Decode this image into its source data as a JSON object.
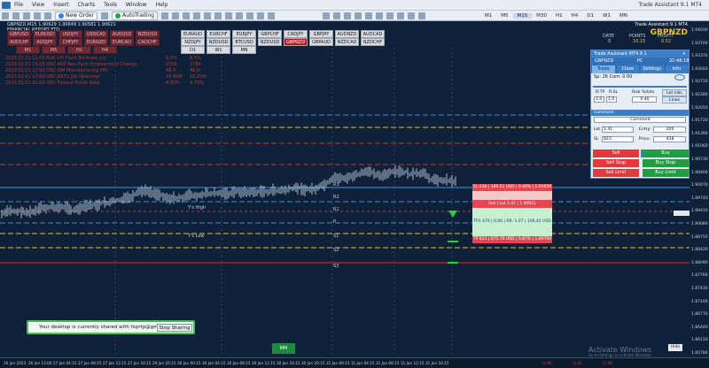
{
  "menu": {
    "items": [
      "File",
      "View",
      "Insert",
      "Charts",
      "Tools",
      "Window",
      "Help"
    ],
    "window_caption": "Trade Assistant 9.1 MT4"
  },
  "toolbar": {
    "new_order": "New Order",
    "autotrading": "AutoTrading",
    "timeframes": [
      "M1",
      "M5",
      "M15",
      "M30",
      "H1",
      "H4",
      "D1",
      "W1",
      "MN"
    ],
    "active_timeframe": "M15"
  },
  "chart": {
    "header": "GBPNZD,M15  1.90629 1.90649 1.90581 1.90621",
    "subtitle": "FINANCIAL REPORT FTD",
    "pairs_row1": [
      "GBPUSD",
      "EURUSD",
      "USDJPY",
      "USDCAD",
      "AUDUSD",
      "NZDUSD",
      "EURAUD",
      "EURCHF",
      "EURJPY",
      "GBPCHF",
      "CADJPY",
      "GBPJPY",
      "AUDNZD",
      "AUDCAD"
    ],
    "pairs_row2": [
      "AUDCHF",
      "AUDJPY",
      "CHFJPY",
      "EURNZD",
      "EURCAD",
      "CADCHF",
      "NZDJPY",
      "NZDUSD",
      "BTCUSD",
      "NZDUSD",
      "GBPNZD",
      "GBPAUD",
      "NZDCAD",
      "NZDCHF"
    ],
    "active_pair": "GBPNZD",
    "tf_buttons": [
      "M1",
      "M5",
      "H1",
      "H4",
      "D1",
      "W1",
      "MN"
    ],
    "news": [
      {
        "time": "2023.01.31 12:00",
        "event": "EUR  CPI Flash Estimate y/y",
        "act": "9.2%",
        "fcst": "8.5%"
      },
      {
        "time": "2023.02.01 15:15",
        "event": "USD  ADP Non-Farm Employment Change",
        "act": "235K",
        "fcst": "178K"
      },
      {
        "time": "2023.02.01 17:00",
        "event": "USD  ISM Manufacturing PMI",
        "act": "48.4",
        "fcst": "48.0"
      },
      {
        "time": "2023.02.01 17:00",
        "event": "USD  JOLTS Job Openings",
        "act": "10.46M",
        "fcst": "10.25M"
      },
      {
        "time": "2023.02.01 21:00",
        "event": "USD  Federal Funds Rate",
        "act": "4.50%",
        "fcst": "4.75%"
      }
    ],
    "level_labels": [
      "Y's High",
      "Y's Low",
      "R3",
      "R2",
      "R1",
      "S1",
      "S2",
      "S3",
      "P"
    ],
    "price_axis": [
      "1.94030",
      "1.93700",
      "1.93370",
      "1.93040",
      "1.92710",
      "1.92380",
      "1.92050",
      "1.91720",
      "1.91390",
      "1.91060",
      "1.90730",
      "1.90400",
      "1.90070",
      "1.89740",
      "1.89410",
      "1.89080",
      "1.88750",
      "1.88420",
      "1.88090",
      "1.87760",
      "1.87430",
      "1.87100",
      "1.86770",
      "1.86440",
      "1.86110",
      "1.85780"
    ],
    "time_axis": [
      "26 Jan 2023",
      "26 Jan 13:00",
      "27 Jan 04:15",
      "27 Jan 08:15",
      "27 Jan 12:15",
      "27 Jan 16:15",
      "29 Jan 20:15",
      "30 Jan 00:15",
      "30 Jan 04:15",
      "30 Jan 08:15",
      "30 Jan 12:15",
      "30 Jan 16:15",
      "30 Jan 20:15",
      "31 Jan 00:15",
      "31 Jan 04:15",
      "31 Jan 08:15",
      "31 Jan 12:15",
      "31 Jan 16:15"
    ],
    "right_tags": [
      "(1 M)",
      "(1 D)",
      "(1 W)"
    ]
  },
  "info_panel": {
    "caption": "Trade Assistant 9.1 MT4",
    "pair": "GBPNZD",
    "cols": [
      "DATE",
      "POINTS",
      "PROFIT"
    ],
    "vals": [
      "0",
      "10.15",
      "0.52"
    ],
    "accent": "#f0c030"
  },
  "trade_assistant": {
    "title": "Trade Assistant MT4 9.1",
    "symbol": "GBPNZD",
    "account": "PC",
    "time": "20:48:18",
    "tabs": [
      "Trade",
      "Close",
      "Settings",
      "Info"
    ],
    "spread": "Sp: 26  Com: 0.00",
    "rtp_label": "R:TP",
    "rsl_label": "R:SL",
    "risk_label": "Risk %/lots",
    "rtp_value": "2.0",
    "rsl_value": "1.0",
    "risk_value": "0.40",
    "lot_calc": "Lot calc",
    "lines": "Lines",
    "comment_header": "Comment",
    "comment_field": "Comment",
    "lot_label": "Lot",
    "lot_value": "1.41",
    "entry_label": "Entry:",
    "entry_value": "200",
    "sl_label": "SL",
    "sl_value": "823",
    "price_label": "Price:",
    "price_value": "438",
    "buttons": {
      "sell": "Sell",
      "buy": "Buy",
      "sell_stop": "Sell Stop",
      "buy_stop": "Buy Stop",
      "sell_limit": "Sell Limit",
      "buy_limit": "Buy Limit"
    }
  },
  "trade_box": {
    "sl": "SL 438 | 389.51 USD | 0.40% | 1.91059",
    "entry": "Sell | Lot 1.41 | 1.90621",
    "tp1": "TP1 479 | 0.00 | RR: 1.07 | 106.42 USD",
    "tp": "TP 823 | 675.78 USD | 0.87% | 1.89798"
  },
  "share_banner": {
    "text": "Your desktop is currently shared with fxprtp@gmail.com",
    "button": "Stop Sharing"
  },
  "mm_button": "MM",
  "hide_button": "Hide",
  "watermark": {
    "line1": "Activate Windows",
    "line2": "Go to Settings to activate Windows."
  }
}
